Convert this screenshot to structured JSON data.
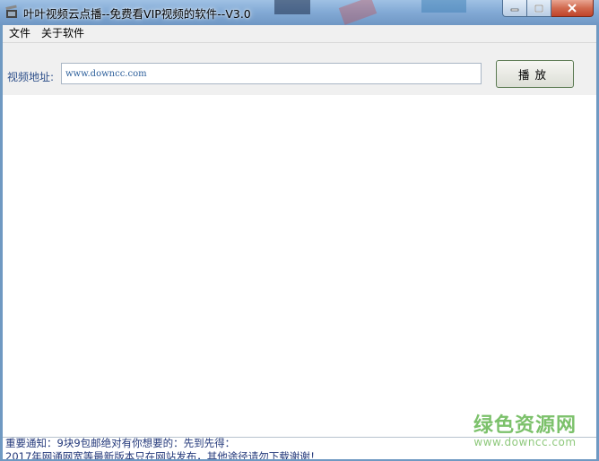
{
  "window": {
    "title": "叶叶视频云点播--免费看VIP视频的软件--V3.0",
    "app_icon": "film-clapper-icon",
    "caption_buttons": [
      "minimize-icon",
      "maximize-icon",
      "close-icon"
    ]
  },
  "menubar": {
    "items": [
      {
        "label": "文件"
      },
      {
        "label": "关于软件"
      }
    ]
  },
  "address": {
    "label": "视频地址:",
    "value": "www.downcc.com",
    "play_label": "播放"
  },
  "notice": {
    "line1": "重要通知：9块9包邮绝对有你想要的：先到先得：",
    "line2": "2017年网通网宽等最新版本只在网站发布，其他途径请勿下载谢谢！"
  },
  "watermark": {
    "main": "绿色资源网",
    "sub": "www.downcc.com"
  },
  "colors": {
    "titlebar": "#84abd6",
    "label_blue": "#2d4f8a",
    "notice_text": "#23387a",
    "watermark_green": "#7cc16b"
  }
}
